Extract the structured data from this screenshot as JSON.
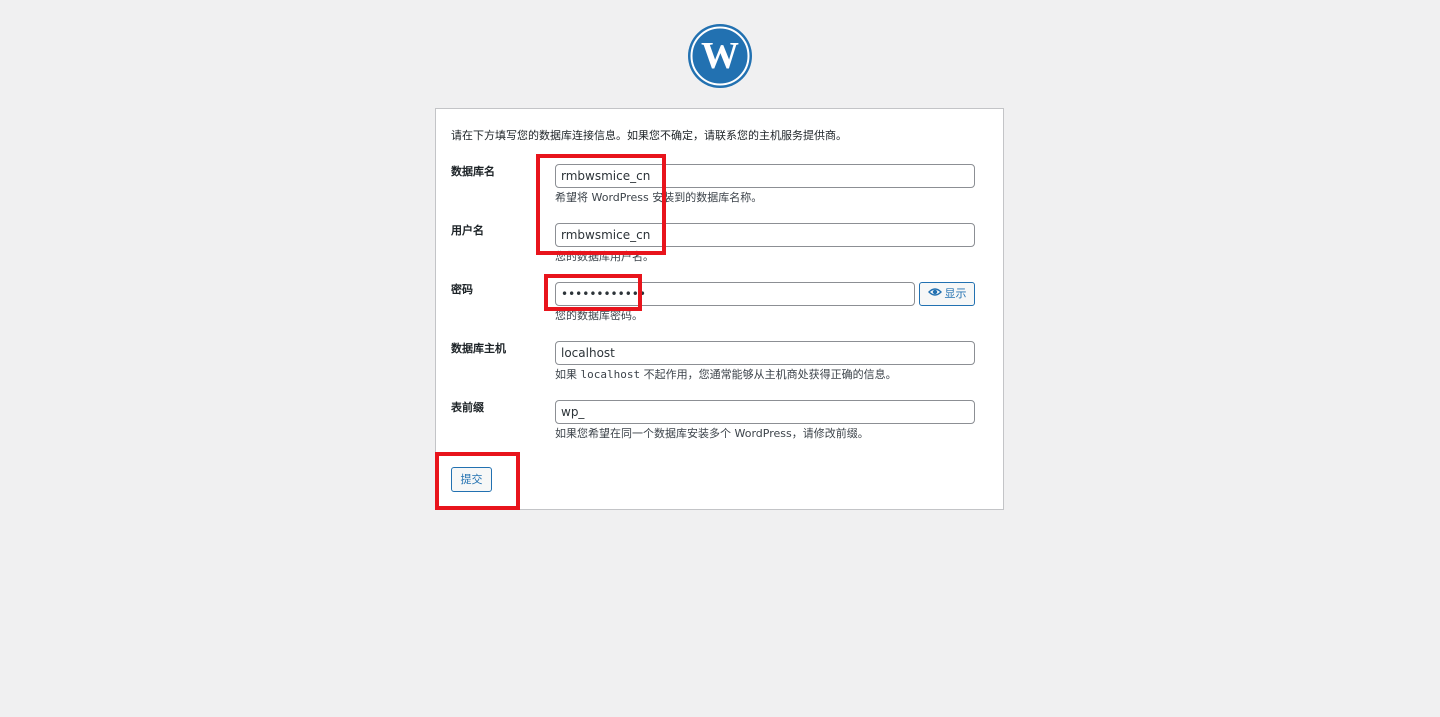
{
  "logo": {
    "icon": "wordpress-logo-icon",
    "color": "#2271b1"
  },
  "intro_text": "请在下方填写您的数据库连接信息。如果您不确定，请联系您的主机服务提供商。",
  "fields": {
    "dbname": {
      "label": "数据库名",
      "value": "rmbwsmice_cn",
      "description": "希望将 WordPress 安装到的数据库名称。"
    },
    "username": {
      "label": "用户名",
      "value": "rmbwsmice_cn",
      "description": "您的数据库用户名。"
    },
    "password": {
      "label": "密码",
      "value": "••••••••••••",
      "description": "您的数据库密码。",
      "show_button_label": "显示",
      "show_icon": "eye-icon"
    },
    "dbhost": {
      "label": "数据库主机",
      "value": "localhost",
      "description_prefix": "如果 ",
      "description_code": "localhost",
      "description_suffix": " 不起作用，您通常能够从主机商处获得正确的信息。"
    },
    "prefix": {
      "label": "表前缀",
      "value": "wp_",
      "description": "如果您希望在同一个数据库安装多个 WordPress，请修改前缀。"
    }
  },
  "submit_label": "提交",
  "colors": {
    "accent": "#2271b1",
    "highlight": "#e8141c",
    "background": "#f0f0f1"
  }
}
